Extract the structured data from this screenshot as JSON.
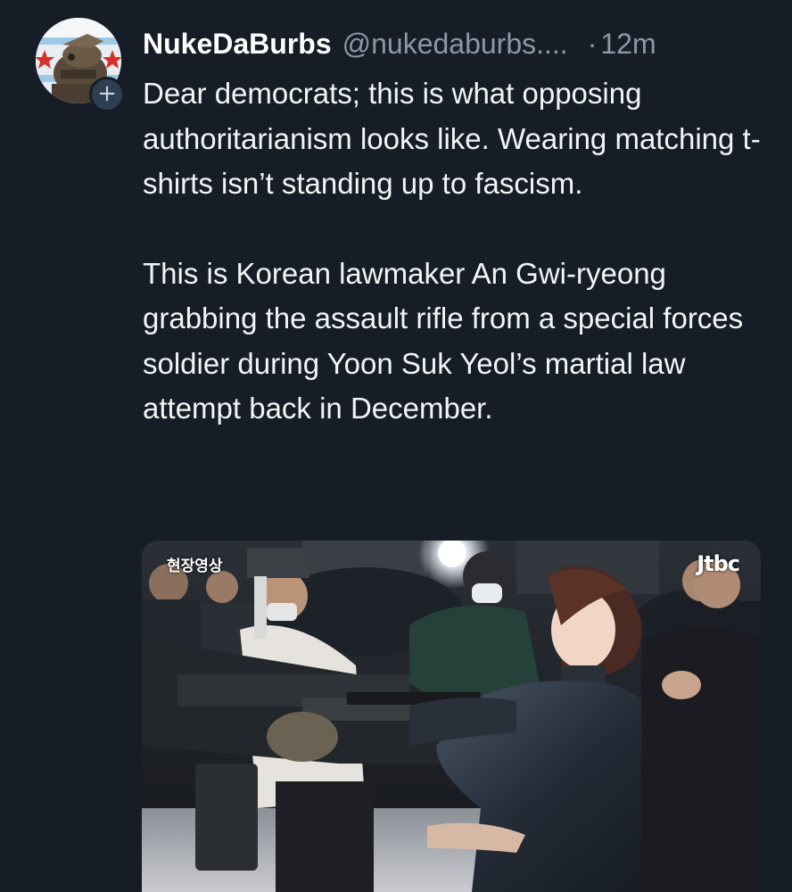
{
  "post": {
    "author": {
      "display_name": "NukeDaBurbs",
      "handle": "@nukedaburbs....",
      "avatar_icon": "user-avatar-icon"
    },
    "follow_badge_symbol": "+",
    "separator": "·",
    "timestamp": "12m",
    "body": {
      "paragraph_1": "Dear democrats; this is what opposing authoritarianism looks like. Wearing matching t-shirts isn’t standing up to fascism.",
      "paragraph_2": "This is Korean lawmaker An Gwi-ryeong grabbing the assault rifle from a special forces soldier during Yoon Suk Yeol’s martial law attempt back in December."
    },
    "media": {
      "overlay_label": "현장영상",
      "channel_logo": "Jtbc"
    }
  },
  "colors": {
    "background": "#161d26",
    "text_primary": "#ffffff",
    "text_secondary": "#8b98a5",
    "badge_background": "#2e3f52"
  }
}
